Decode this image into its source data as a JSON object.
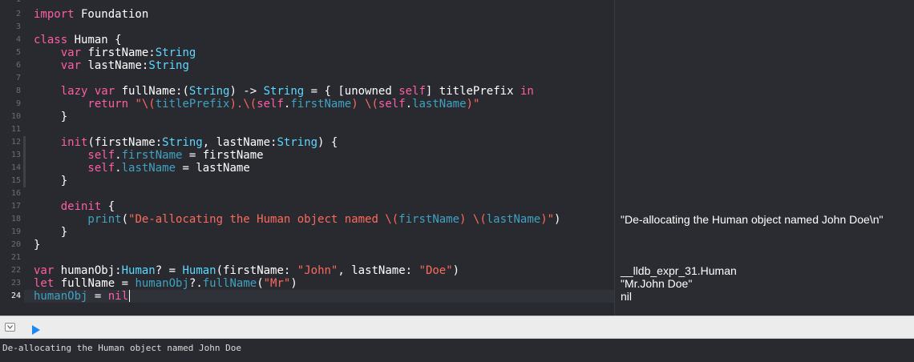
{
  "editor": {
    "line_numbers": [
      "1",
      "2",
      "3",
      "4",
      "5",
      "6",
      "7",
      "8",
      "9",
      "10",
      "11",
      "12",
      "13",
      "14",
      "15",
      "16",
      "17",
      "18",
      "19",
      "20",
      "21",
      "22",
      "23",
      "24"
    ],
    "current_line": "24",
    "code": {
      "l2": {
        "a": "import",
        "b": " Foundation"
      },
      "l4": {
        "a": "class",
        "b": " Human {"
      },
      "l5": {
        "a": "    var",
        "b": " firstName:",
        "c": "String"
      },
      "l6": {
        "a": "    var",
        "b": " lastName:",
        "c": "String"
      },
      "l8": {
        "a": "    lazy var",
        "b": " fullName:(",
        "c": "String",
        "d": ") -> ",
        "e": "String",
        "f": " = { [unowned ",
        "g": "self",
        "h": "] titlePrefix ",
        "i": "in"
      },
      "l9": {
        "a": "        return",
        "b": " ",
        "c": "\"\\(",
        "d": "titlePrefix",
        "e": ").\\(",
        "f": "self",
        "g": ".",
        "h": "firstName",
        "i": ") \\(",
        "j": "self",
        "k": ".",
        "l": "lastName",
        "m": ")\""
      },
      "l10": {
        "a": "    }"
      },
      "l12": {
        "a": "    init",
        "b": "(firstName:",
        "c": "String",
        "d": ", lastName:",
        "e": "String",
        "f": ") {"
      },
      "l13": {
        "a": "        self",
        "b": ".",
        "c": "firstName",
        "d": " = firstName"
      },
      "l14": {
        "a": "        self",
        "b": ".",
        "c": "lastName",
        "d": " = lastName"
      },
      "l15": {
        "a": "    }"
      },
      "l17": {
        "a": "    deinit",
        "b": " {"
      },
      "l18": {
        "a": "        print",
        "b": "(",
        "c": "\"De-allocating the Human object named \\(",
        "d": "firstName",
        "e": ") \\(",
        "f": "lastName",
        "g": ")\"",
        "h": ")"
      },
      "l19": {
        "a": "    }"
      },
      "l20": {
        "a": "}"
      },
      "l22": {
        "a": "var",
        "b": " humanObj:",
        "c": "Human",
        "d": "? = ",
        "e": "Human",
        "f": "(firstName: ",
        "g": "\"John\"",
        "h": ", lastName: ",
        "i": "\"Doe\"",
        "j": ")"
      },
      "l23": {
        "a": "let",
        "b": " fullName = ",
        "c": "humanObj",
        "d": "?.",
        "e": "fullName",
        "f": "(",
        "g": "\"Mr\"",
        "h": ")"
      },
      "l24": {
        "a": "humanObj",
        "b": " = ",
        "c": "nil"
      }
    }
  },
  "results": {
    "r18": "\"De-allocating the Human object named John Doe\\n\"",
    "r22": "__lldb_expr_31.Human",
    "r23": "\"Mr.John Doe\"",
    "r24": "nil"
  },
  "toolbar": {
    "hide_debug_icon": "debug-area-toggle-icon",
    "run_icon": "play-triangle-icon",
    "run_color": "#1f87f5"
  },
  "console": {
    "output": "De-allocating the Human object named John Doe"
  },
  "colors": {
    "background": "#292a30",
    "keyword": "#fc5fa3",
    "type": "#5dd8ff",
    "identifier": "#41a1c0",
    "string": "#fc6a5d"
  }
}
